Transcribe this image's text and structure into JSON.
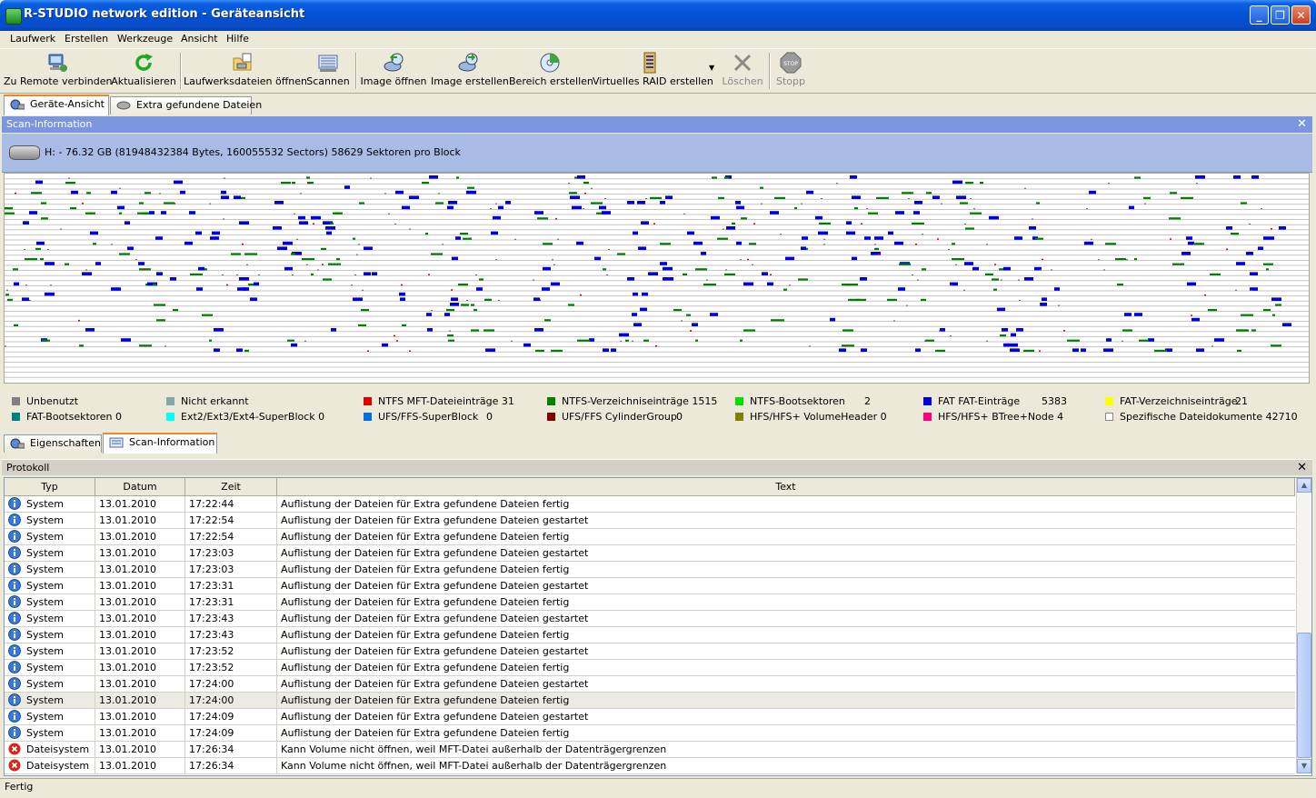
{
  "window": {
    "title": "R-STUDIO network edition - Geräteansicht"
  },
  "menu": [
    "Laufwerk",
    "Erstellen",
    "Werkzeuge",
    "Ansicht",
    "Hilfe"
  ],
  "toolbar": [
    {
      "label": "Zu Remote verbinden",
      "icon": "remote-connect-icon",
      "enabled": true
    },
    {
      "label": "Aktualisieren",
      "icon": "refresh-icon",
      "enabled": true
    },
    {
      "label": "Laufwerksdateien öffnen",
      "icon": "open-drive-files-icon",
      "enabled": true
    },
    {
      "label": "Scannen",
      "icon": "scan-icon",
      "enabled": true
    },
    {
      "label": "Image öffnen",
      "icon": "open-image-icon",
      "enabled": true
    },
    {
      "label": "Image erstellen",
      "icon": "create-image-icon",
      "enabled": true
    },
    {
      "label": "Bereich erstellen",
      "icon": "create-region-icon",
      "enabled": true
    },
    {
      "label": "Virtuelles RAID erstellen",
      "icon": "raid-icon",
      "enabled": true
    },
    {
      "label": "Löschen",
      "icon": "delete-icon",
      "enabled": false
    },
    {
      "label": "Stopp",
      "icon": "stop-icon",
      "enabled": false
    }
  ],
  "top_tabs": [
    "Geräte-Ansicht",
    "Extra gefundene Dateien"
  ],
  "scan_panel": {
    "header": "Scan-Information",
    "disk_info": "H: - 76.32 GB (81948432384 Bytes, 160055532 Sectors) 58629 Sektoren pro Block"
  },
  "legend": [
    {
      "label": "Unbenutzt",
      "value": "",
      "color": "#808080"
    },
    {
      "label": "Nicht erkannt",
      "value": "",
      "color": "#80a8a8"
    },
    {
      "label": "NTFS MFT-Dateieinträge 31",
      "value": "",
      "color": "#e00000"
    },
    {
      "label": "NTFS-Verzeichniseinträge 1515",
      "value": "",
      "color": "#008000"
    },
    {
      "label": "NTFS-Bootsektoren",
      "value": "2",
      "color": "#00e000"
    },
    {
      "label": "FAT FAT-Einträge",
      "value": "5383",
      "color": "#0000e0"
    },
    {
      "label": "FAT-Verzeichniseinträge",
      "value": "21",
      "color": "#ffff00"
    },
    {
      "label": "FAT-Bootsektoren 0",
      "value": "",
      "color": "#008080"
    },
    {
      "label": "Ext2/Ext3/Ext4-SuperBlock 0",
      "value": "",
      "color": "#00ffff"
    },
    {
      "label": "UFS/FFS-SuperBlock",
      "value": "0",
      "color": "#0070e0"
    },
    {
      "label": "UFS/FFS CylinderGroup",
      "value": "0",
      "color": "#800000"
    },
    {
      "label": "HFS/HFS+ VolumeHeader 0",
      "value": "",
      "color": "#808000"
    },
    {
      "label": "HFS/HFS+ BTree+Node 4",
      "value": "",
      "color": "#ff0080"
    },
    {
      "label": "Spezifische Dateidokumente 42710",
      "value": "",
      "color": "#ffffff"
    }
  ],
  "bottom_tabs": [
    "Eigenschaften",
    "Scan-Information"
  ],
  "log": {
    "header": "Protokoll",
    "columns": [
      "Typ",
      "Datum",
      "Zeit",
      "Text"
    ],
    "rows": [
      {
        "type": "System",
        "date": "13.01.2010",
        "time": "17:22:44",
        "text": "Auflistung der Dateien für Extra gefundene Dateien fertig",
        "icon": "info-icon"
      },
      {
        "type": "System",
        "date": "13.01.2010",
        "time": "17:22:54",
        "text": "Auflistung der Dateien für Extra gefundene Dateien gestartet",
        "icon": "info-icon"
      },
      {
        "type": "System",
        "date": "13.01.2010",
        "time": "17:22:54",
        "text": "Auflistung der Dateien für Extra gefundene Dateien fertig",
        "icon": "info-icon"
      },
      {
        "type": "System",
        "date": "13.01.2010",
        "time": "17:23:03",
        "text": "Auflistung der Dateien für Extra gefundene Dateien gestartet",
        "icon": "info-icon"
      },
      {
        "type": "System",
        "date": "13.01.2010",
        "time": "17:23:03",
        "text": "Auflistung der Dateien für Extra gefundene Dateien fertig",
        "icon": "info-icon"
      },
      {
        "type": "System",
        "date": "13.01.2010",
        "time": "17:23:31",
        "text": "Auflistung der Dateien für Extra gefundene Dateien gestartet",
        "icon": "info-icon"
      },
      {
        "type": "System",
        "date": "13.01.2010",
        "time": "17:23:31",
        "text": "Auflistung der Dateien für Extra gefundene Dateien fertig",
        "icon": "info-icon"
      },
      {
        "type": "System",
        "date": "13.01.2010",
        "time": "17:23:43",
        "text": "Auflistung der Dateien für Extra gefundene Dateien gestartet",
        "icon": "info-icon"
      },
      {
        "type": "System",
        "date": "13.01.2010",
        "time": "17:23:43",
        "text": "Auflistung der Dateien für Extra gefundene Dateien fertig",
        "icon": "info-icon"
      },
      {
        "type": "System",
        "date": "13.01.2010",
        "time": "17:23:52",
        "text": "Auflistung der Dateien für Extra gefundene Dateien gestartet",
        "icon": "info-icon"
      },
      {
        "type": "System",
        "date": "13.01.2010",
        "time": "17:23:52",
        "text": "Auflistung der Dateien für Extra gefundene Dateien fertig",
        "icon": "info-icon"
      },
      {
        "type": "System",
        "date": "13.01.2010",
        "time": "17:24:00",
        "text": "Auflistung der Dateien für Extra gefundene Dateien gestartet",
        "icon": "info-icon"
      },
      {
        "type": "System",
        "date": "13.01.2010",
        "time": "17:24:00",
        "text": "Auflistung der Dateien für Extra gefundene Dateien fertig",
        "icon": "info-icon",
        "selected": true
      },
      {
        "type": "System",
        "date": "13.01.2010",
        "time": "17:24:09",
        "text": "Auflistung der Dateien für Extra gefundene Dateien gestartet",
        "icon": "info-icon"
      },
      {
        "type": "System",
        "date": "13.01.2010",
        "time": "17:24:09",
        "text": "Auflistung der Dateien für Extra gefundene Dateien fertig",
        "icon": "info-icon"
      },
      {
        "type": "Dateisystem",
        "date": "13.01.2010",
        "time": "17:26:34",
        "text": "Kann Volume nicht öffnen, weil MFT-Datei außerhalb der Datenträgergrenzen",
        "icon": "error-icon"
      },
      {
        "type": "Dateisystem",
        "date": "13.01.2010",
        "time": "17:26:34",
        "text": "Kann Volume nicht öffnen, weil MFT-Datei außerhalb der Datenträgergrenzen",
        "icon": "error-icon"
      }
    ]
  },
  "status": "Fertig"
}
